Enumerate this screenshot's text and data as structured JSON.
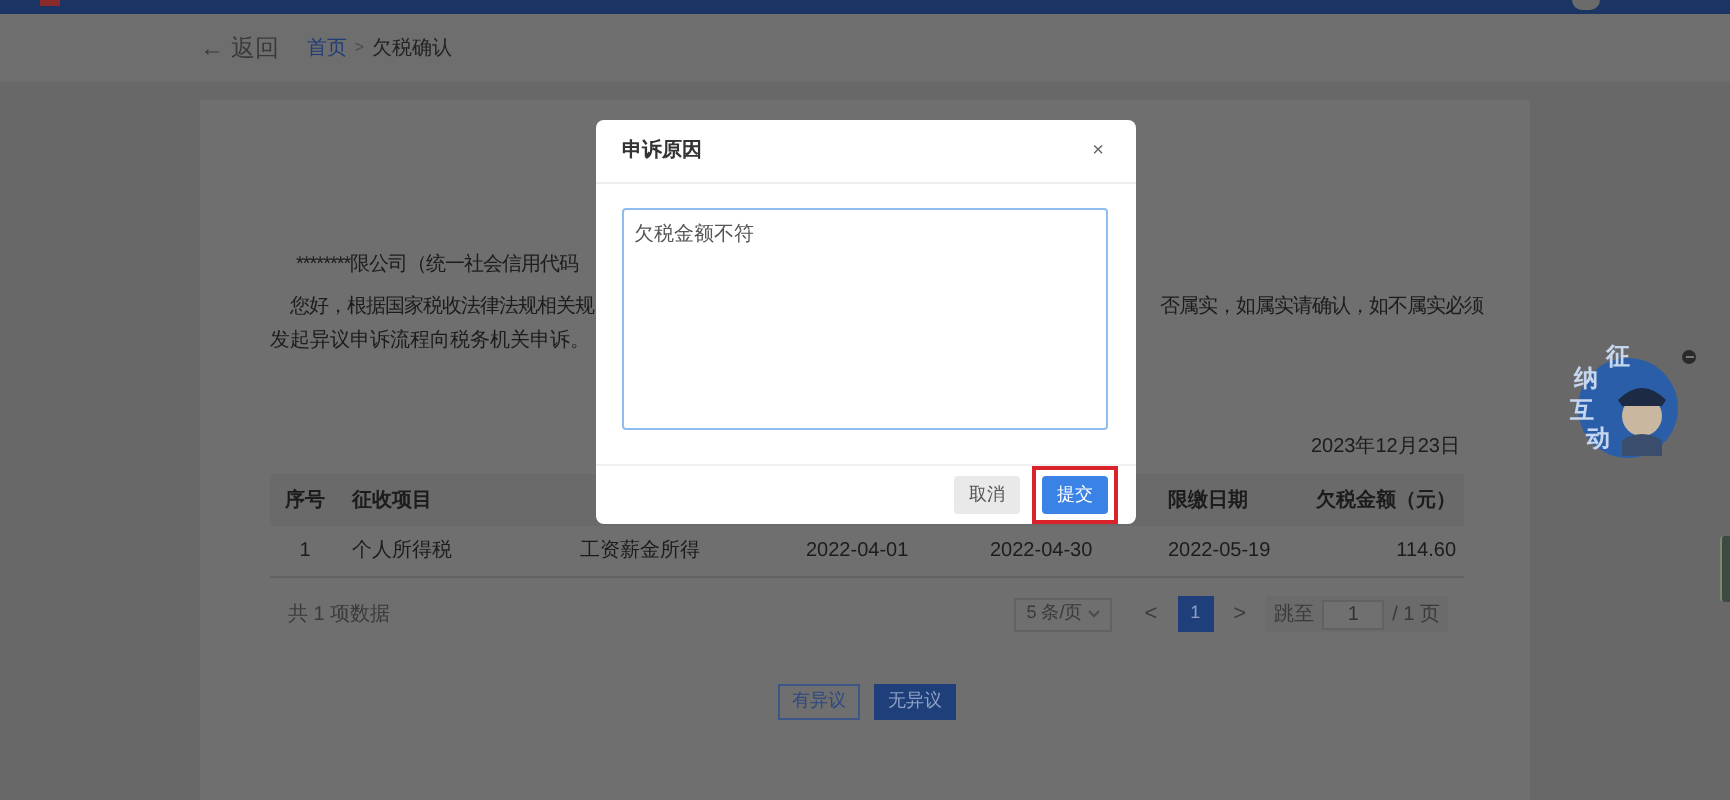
{
  "breadcrumb": {
    "back": "← 返回",
    "items": [
      {
        "label": "首页",
        "kind": "link"
      },
      {
        "label": "欠税确认",
        "kind": "current"
      }
    ],
    "separator": ">"
  },
  "notice": {
    "line_1": "********限公司（统一社会信用代码",
    "line_2_left": "您好，根据国家税收法律法规相关规",
    "line_2_right": "否属实，如属实请确认，如不属实必须",
    "line_3": "发起异议申诉流程向税务机关申诉。",
    "date": "2023年12月23日"
  },
  "table": {
    "columns": [
      {
        "label": "序号"
      },
      {
        "label": "征收项目"
      },
      {},
      {},
      {},
      {
        "label": "限缴日期"
      },
      {
        "label": "欠税金额（元）"
      }
    ],
    "rows": [
      [
        "1",
        "个人所得税",
        "工资薪金所得",
        "2022-04-01",
        "2022-04-30",
        "2022-05-19",
        "114.60"
      ]
    ]
  },
  "pagination": {
    "total": "共 1 项数据",
    "page_size": "5 条/页",
    "prev": "<",
    "pages": [
      {
        "label": "1",
        "selected": true
      }
    ],
    "next": ">",
    "jump_label": "跳至",
    "jump_value": "1",
    "page_count": "/ 1 页"
  },
  "actions": [
    {
      "label": "有异议",
      "kind": "outline"
    },
    {
      "label": "无异议",
      "kind": "primary"
    }
  ],
  "mascot": {
    "characters": [
      "征",
      "纳",
      "互",
      "动"
    ]
  },
  "dialog": {
    "title": "申诉原因",
    "close": "×",
    "textarea_value": "欠税金额不符",
    "buttons": [
      {
        "label": "取消",
        "kind": "default",
        "highlighted": false
      },
      {
        "label": "提交",
        "kind": "primary",
        "highlighted": true
      }
    ]
  }
}
